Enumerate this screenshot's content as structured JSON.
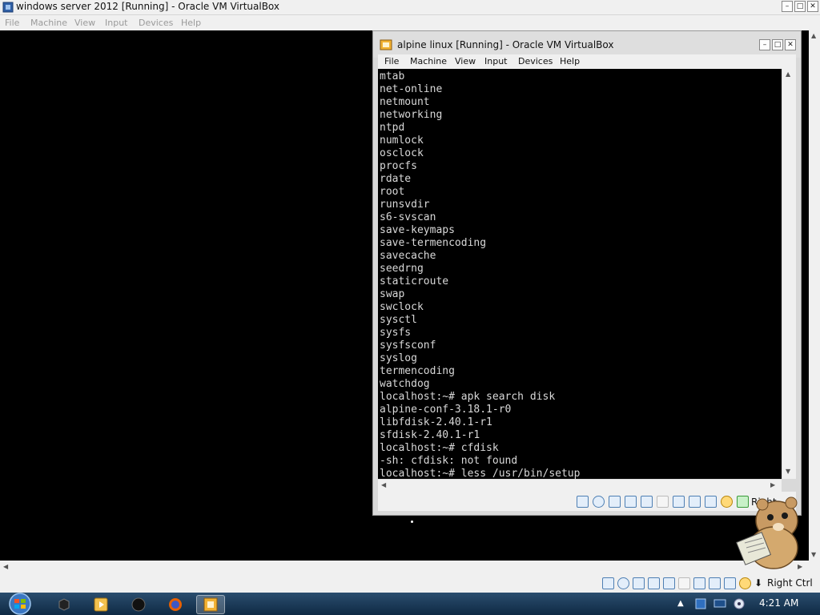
{
  "outer_window": {
    "title": "windows server 2012 [Running] - Oracle VM VirtualBox",
    "menu": [
      "File",
      "Machine",
      "View",
      "Input",
      "Devices",
      "Help"
    ],
    "host_key": "Right Ctrl"
  },
  "inner_window": {
    "title": "alpine linux [Running] - Oracle VM VirtualBox",
    "menu": [
      "File",
      "Machine",
      "View",
      "Input",
      "Devices",
      "Help"
    ],
    "host_key": "Right"
  },
  "terminal": {
    "lines": [
      "mtab",
      "net-online",
      "netmount",
      "networking",
      "ntpd",
      "numlock",
      "osclock",
      "procfs",
      "rdate",
      "root",
      "runsvdir",
      "s6-svscan",
      "save-keymaps",
      "save-termencoding",
      "savecache",
      "seedrng",
      "staticroute",
      "swap",
      "swclock",
      "sysctl",
      "sysfs",
      "sysfsconf",
      "syslog",
      "termencoding",
      "watchdog",
      "localhost:~# apk search disk",
      "alpine-conf-3.18.1-r0",
      "libfdisk-2.40.1-r1",
      "sfdisk-2.40.1-r1",
      "localhost:~# cfdisk",
      "-sh: cfdisk: not found",
      "localhost:~# less /usr/bin/setup"
    ]
  },
  "taskbar": {
    "clock": "4:21 AM"
  },
  "colors": {
    "taskbar": "#1b3a58",
    "terminal_bg": "#000000",
    "terminal_fg": "#d8d8d8"
  }
}
